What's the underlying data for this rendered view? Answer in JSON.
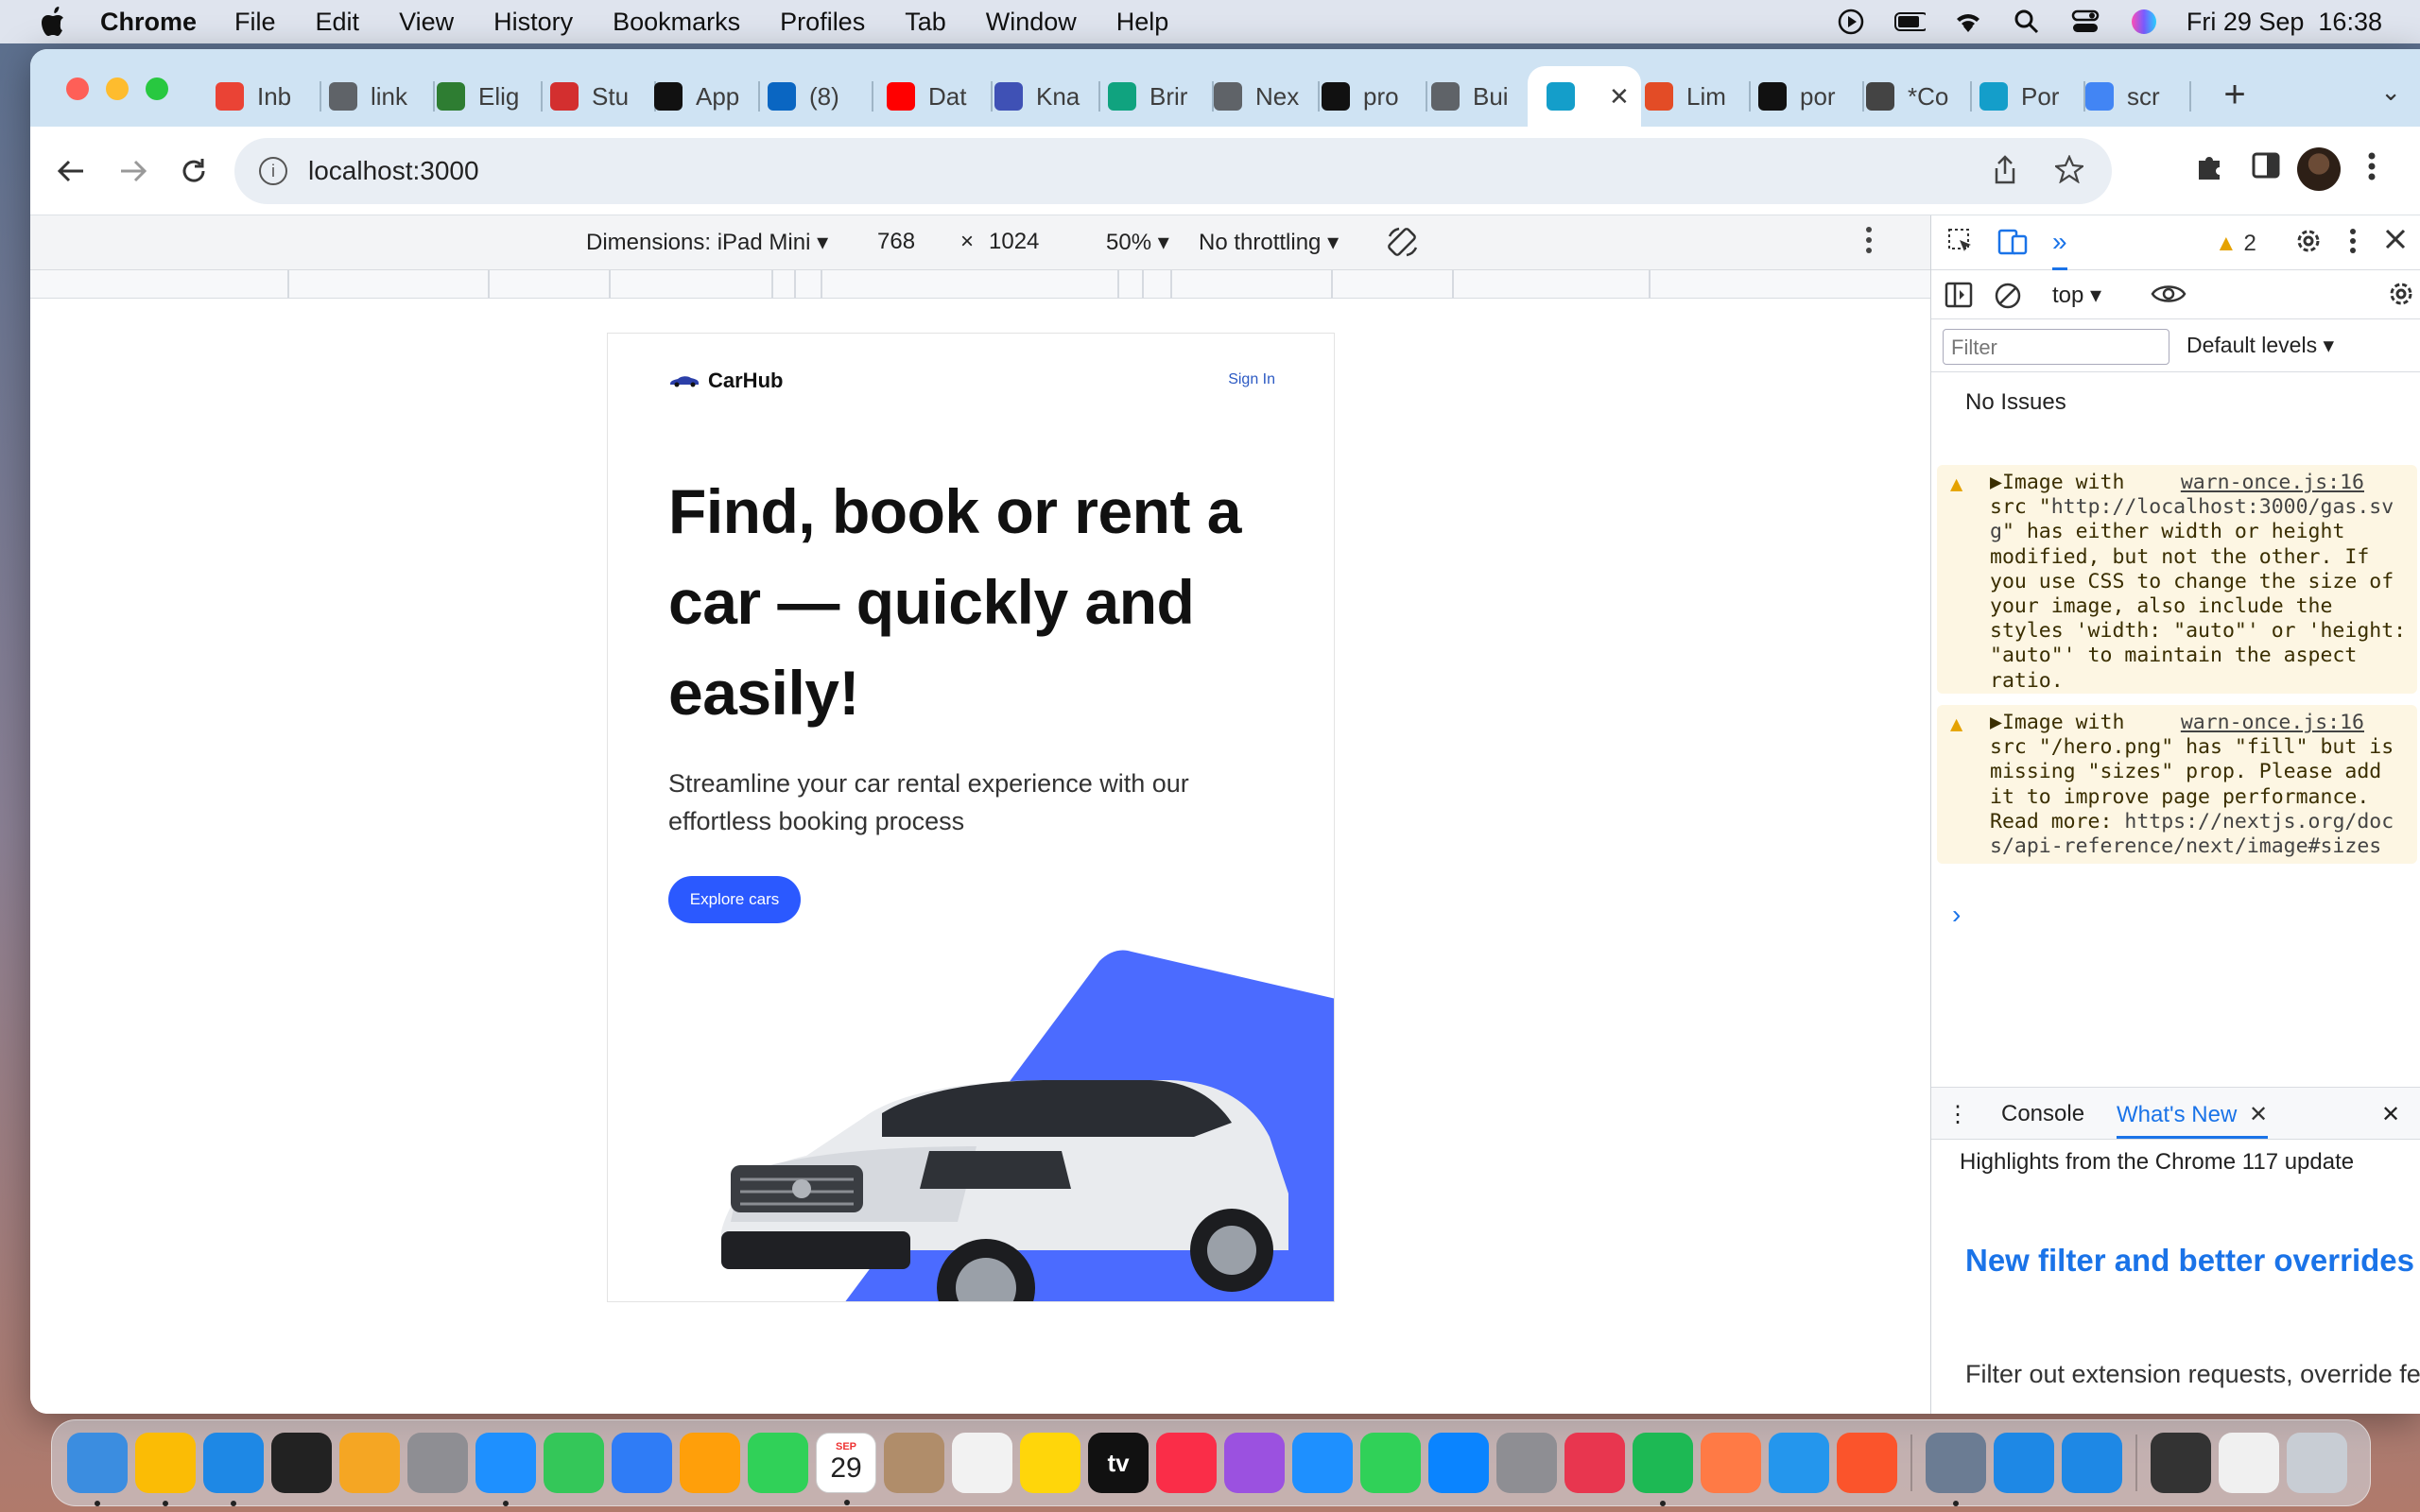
{
  "menubar": {
    "app_name": "Chrome",
    "menus": [
      "File",
      "Edit",
      "View",
      "History",
      "Bookmarks",
      "Profiles",
      "Tab",
      "Window",
      "Help"
    ],
    "datetime": "Fri 29 Sep  16:38"
  },
  "tabs": [
    {
      "label": "Inb",
      "icon": "gmail-icon",
      "color": "#ea4335"
    },
    {
      "label": "link",
      "icon": "globe-icon",
      "color": "#5f6368"
    },
    {
      "label": "Elig",
      "icon": "shield-crest-icon",
      "color": "#2e7d32"
    },
    {
      "label": "Stu",
      "icon": "maple-leaf-icon",
      "color": "#d32f2f"
    },
    {
      "label": "App",
      "icon": "opensea-icon",
      "color": "#111111"
    },
    {
      "label": "(8)",
      "icon": "linkedin-icon",
      "color": "#0a66c2"
    },
    {
      "label": "Dat",
      "icon": "youtube-icon",
      "color": "#ff0000"
    },
    {
      "label": "Kna",
      "icon": "kna-icon",
      "color": "#3f51b5"
    },
    {
      "label": "Brir",
      "icon": "openai-icon",
      "color": "#10a37f"
    },
    {
      "label": "Nex",
      "icon": "globe-icon",
      "color": "#5f6368"
    },
    {
      "label": "pro",
      "icon": "github-icon",
      "color": "#111111"
    },
    {
      "label": "Bui",
      "icon": "globe-icon",
      "color": "#5f6368"
    },
    {
      "label": "",
      "icon": "react-icon",
      "color": "#149eca",
      "active": true
    },
    {
      "label": "Lim",
      "icon": "html-icon",
      "color": "#e34c26"
    },
    {
      "label": "por",
      "icon": "github-icon",
      "color": "#111111"
    },
    {
      "label": "*Co",
      "icon": "wikipedia-icon",
      "color": "#444444"
    },
    {
      "label": "Por",
      "icon": "react-icon",
      "color": "#149eca"
    },
    {
      "label": "scr",
      "icon": "google-icon",
      "color": "#4285f4"
    }
  ],
  "address": {
    "url": "localhost:3000"
  },
  "device_toolbar": {
    "dimensions_label": "Dimensions: iPad Mini",
    "width": "768",
    "times": "×",
    "height": "1024",
    "zoom": "50%",
    "throttling": "No throttling"
  },
  "site": {
    "brand": "CarHub",
    "sign_in": "Sign In",
    "hero_title": "Find, book or rent a car — quickly and easily!",
    "hero_subtitle": "Streamline your car rental experience with our effortless booking process",
    "cta": "Explore cars",
    "accent": "#2b59ff"
  },
  "devtools": {
    "warning_count": "2",
    "context": "top",
    "filter_placeholder": "Filter",
    "levels": "Default levels",
    "issues": "No Issues",
    "warnings": [
      {
        "source": "warn-once.js:16",
        "lead": "Image with",
        "body_pre": "src \"",
        "link": "http://localhost:3000/gas.svg",
        "body_post": "\" has either width or height modified, but not the other. If you use CSS to change the size of your image, also include the styles 'width: \"auto\"' or 'height: \"auto\"' to maintain the aspect ratio."
      },
      {
        "source": "warn-once.js:16",
        "lead": "Image with",
        "body_pre": "src \"/hero.png\" has \"fill\" but is missing \"sizes\" prop. Please add it to improve page performance. Read more: ",
        "link": "https://nextjs.org/docs/api-reference/next/image#sizes",
        "body_post": ""
      }
    ],
    "drawer_tabs": [
      "Console",
      "What's New"
    ],
    "highlights": "Highlights from the Chrome 117 update",
    "whats_new_title": "New filter and better overrides in Network panel",
    "whats_new_desc": "Filter out extension requests, override fetch and XHR requests, mock with overrides faster, better UI, and more."
  },
  "dock": [
    {
      "name": "finder-icon",
      "color": "#3b8de0"
    },
    {
      "name": "chrome-icon",
      "color": "#fbbc05"
    },
    {
      "name": "vscode-icon",
      "color": "#1e88e5"
    },
    {
      "name": "terminal-icon",
      "color": "#222222"
    },
    {
      "name": "sublime-icon",
      "color": "#f5a623"
    },
    {
      "name": "launchpad-icon",
      "color": "#8e8e93"
    },
    {
      "name": "safari-icon",
      "color": "#1e90ff"
    },
    {
      "name": "messages-icon",
      "color": "#34c759"
    },
    {
      "name": "mail-icon",
      "color": "#2f7cf6"
    },
    {
      "name": "photos-icon",
      "color": "#ff9f0a"
    },
    {
      "name": "facetime-icon",
      "color": "#30d158"
    },
    {
      "name": "calendar-icon",
      "color": "#ffffff",
      "month": "SEP",
      "day": "29"
    },
    {
      "name": "contacts-icon",
      "color": "#b08d6a"
    },
    {
      "name": "reminders-icon",
      "color": "#f2f2f2"
    },
    {
      "name": "notes-icon",
      "color": "#ffd60a"
    },
    {
      "name": "appletv-icon",
      "color": "#111111",
      "text": "tv"
    },
    {
      "name": "music-icon",
      "color": "#fa2d48"
    },
    {
      "name": "podcasts-icon",
      "color": "#9b51e0"
    },
    {
      "name": "keynote-icon",
      "color": "#1e90ff"
    },
    {
      "name": "numbers-icon",
      "color": "#30d158"
    },
    {
      "name": "appstore-icon",
      "color": "#0a84ff"
    },
    {
      "name": "system-settings-icon",
      "color": "#8e8e93"
    },
    {
      "name": "creative-cloud-icon",
      "color": "#e8364f"
    },
    {
      "name": "spotify-icon",
      "color": "#1db954"
    },
    {
      "name": "pen-tool-icon",
      "color": "#ff7a45"
    },
    {
      "name": "docker-icon",
      "color": "#2496ed"
    },
    {
      "name": "brave-icon",
      "color": "#fb542b"
    },
    {
      "name": "preview-icon",
      "color": "#6b7c93"
    },
    {
      "name": "vscode-icon-2",
      "color": "#1e88e5"
    },
    {
      "name": "vscode-icon-3",
      "color": "#1e88e5"
    },
    {
      "name": "window-thumbnail-icon",
      "color": "#333333"
    },
    {
      "name": "document-thumbnail-icon",
      "color": "#f0f0f0"
    },
    {
      "name": "trash-icon",
      "color": "#c8cdd4"
    }
  ]
}
